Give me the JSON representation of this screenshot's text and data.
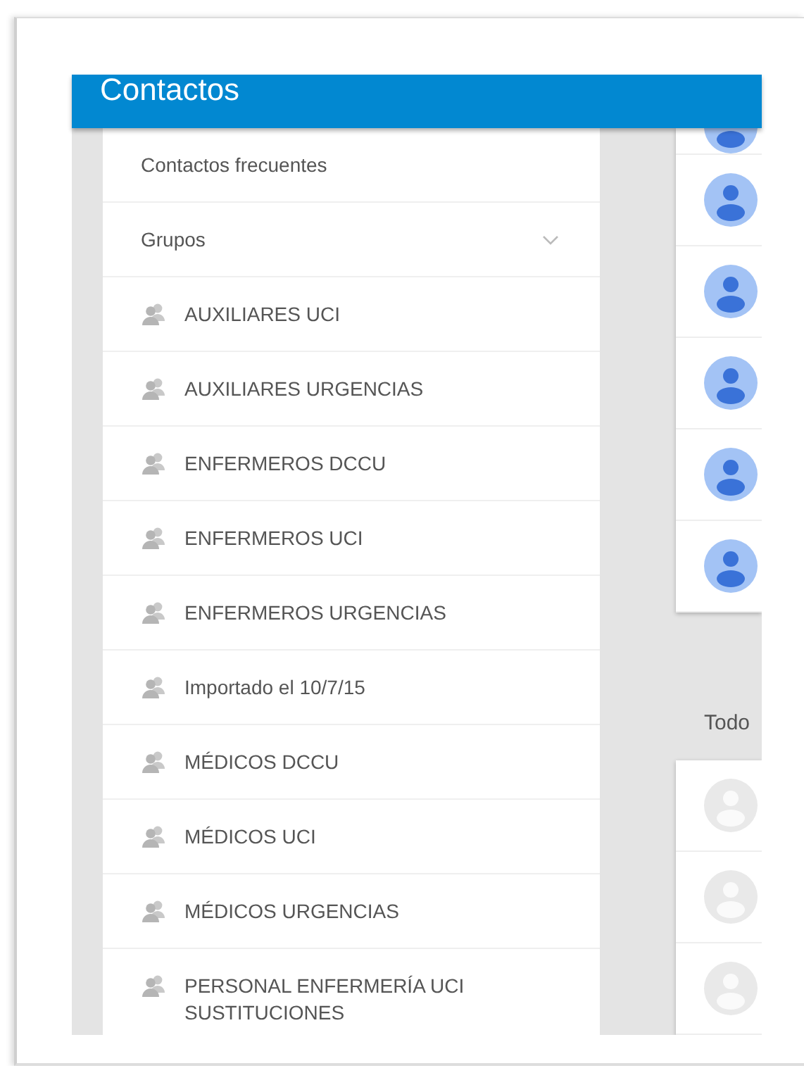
{
  "header": {
    "title": "Contactos"
  },
  "sidebar": {
    "items": [
      {
        "kind": "link",
        "label": "Contactos frecuentes"
      },
      {
        "kind": "section",
        "label": "Grupos",
        "expanded": true,
        "children": [
          {
            "label": "AUXILIARES UCI"
          },
          {
            "label": "AUXILIARES URGENCIAS"
          },
          {
            "label": "ENFERMEROS DCCU"
          },
          {
            "label": "ENFERMEROS UCI"
          },
          {
            "label": "ENFERMEROS URGENCIAS"
          },
          {
            "label": "Importado el 10/7/15"
          },
          {
            "label": "MÉDICOS DCCU"
          },
          {
            "label": "MÉDICOS UCI"
          },
          {
            "label": "MÉDICOS URGENCIAS"
          },
          {
            "label": "PERSONAL ENFERMERÍA UCI SUSTITUCIONES"
          }
        ]
      }
    ]
  },
  "contacts": {
    "section_label": "Todo"
  }
}
